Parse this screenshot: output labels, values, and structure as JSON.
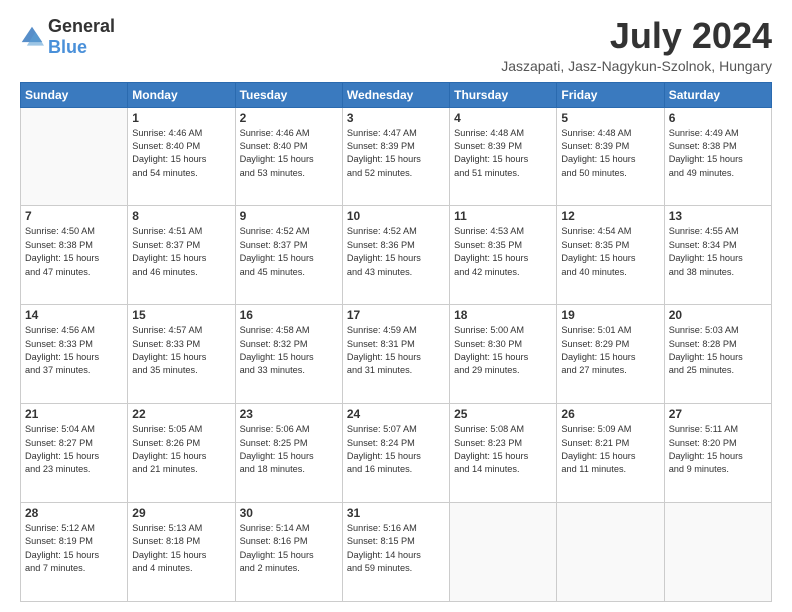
{
  "header": {
    "logo_general": "General",
    "logo_blue": "Blue",
    "month_title": "July 2024",
    "location": "Jaszapati, Jasz-Nagykun-Szolnok, Hungary"
  },
  "days_of_week": [
    "Sunday",
    "Monday",
    "Tuesday",
    "Wednesday",
    "Thursday",
    "Friday",
    "Saturday"
  ],
  "weeks": [
    [
      {
        "day": "",
        "info": ""
      },
      {
        "day": "1",
        "info": "Sunrise: 4:46 AM\nSunset: 8:40 PM\nDaylight: 15 hours\nand 54 minutes."
      },
      {
        "day": "2",
        "info": "Sunrise: 4:46 AM\nSunset: 8:40 PM\nDaylight: 15 hours\nand 53 minutes."
      },
      {
        "day": "3",
        "info": "Sunrise: 4:47 AM\nSunset: 8:39 PM\nDaylight: 15 hours\nand 52 minutes."
      },
      {
        "day": "4",
        "info": "Sunrise: 4:48 AM\nSunset: 8:39 PM\nDaylight: 15 hours\nand 51 minutes."
      },
      {
        "day": "5",
        "info": "Sunrise: 4:48 AM\nSunset: 8:39 PM\nDaylight: 15 hours\nand 50 minutes."
      },
      {
        "day": "6",
        "info": "Sunrise: 4:49 AM\nSunset: 8:38 PM\nDaylight: 15 hours\nand 49 minutes."
      }
    ],
    [
      {
        "day": "7",
        "info": "Sunrise: 4:50 AM\nSunset: 8:38 PM\nDaylight: 15 hours\nand 47 minutes."
      },
      {
        "day": "8",
        "info": "Sunrise: 4:51 AM\nSunset: 8:37 PM\nDaylight: 15 hours\nand 46 minutes."
      },
      {
        "day": "9",
        "info": "Sunrise: 4:52 AM\nSunset: 8:37 PM\nDaylight: 15 hours\nand 45 minutes."
      },
      {
        "day": "10",
        "info": "Sunrise: 4:52 AM\nSunset: 8:36 PM\nDaylight: 15 hours\nand 43 minutes."
      },
      {
        "day": "11",
        "info": "Sunrise: 4:53 AM\nSunset: 8:35 PM\nDaylight: 15 hours\nand 42 minutes."
      },
      {
        "day": "12",
        "info": "Sunrise: 4:54 AM\nSunset: 8:35 PM\nDaylight: 15 hours\nand 40 minutes."
      },
      {
        "day": "13",
        "info": "Sunrise: 4:55 AM\nSunset: 8:34 PM\nDaylight: 15 hours\nand 38 minutes."
      }
    ],
    [
      {
        "day": "14",
        "info": "Sunrise: 4:56 AM\nSunset: 8:33 PM\nDaylight: 15 hours\nand 37 minutes."
      },
      {
        "day": "15",
        "info": "Sunrise: 4:57 AM\nSunset: 8:33 PM\nDaylight: 15 hours\nand 35 minutes."
      },
      {
        "day": "16",
        "info": "Sunrise: 4:58 AM\nSunset: 8:32 PM\nDaylight: 15 hours\nand 33 minutes."
      },
      {
        "day": "17",
        "info": "Sunrise: 4:59 AM\nSunset: 8:31 PM\nDaylight: 15 hours\nand 31 minutes."
      },
      {
        "day": "18",
        "info": "Sunrise: 5:00 AM\nSunset: 8:30 PM\nDaylight: 15 hours\nand 29 minutes."
      },
      {
        "day": "19",
        "info": "Sunrise: 5:01 AM\nSunset: 8:29 PM\nDaylight: 15 hours\nand 27 minutes."
      },
      {
        "day": "20",
        "info": "Sunrise: 5:03 AM\nSunset: 8:28 PM\nDaylight: 15 hours\nand 25 minutes."
      }
    ],
    [
      {
        "day": "21",
        "info": "Sunrise: 5:04 AM\nSunset: 8:27 PM\nDaylight: 15 hours\nand 23 minutes."
      },
      {
        "day": "22",
        "info": "Sunrise: 5:05 AM\nSunset: 8:26 PM\nDaylight: 15 hours\nand 21 minutes."
      },
      {
        "day": "23",
        "info": "Sunrise: 5:06 AM\nSunset: 8:25 PM\nDaylight: 15 hours\nand 18 minutes."
      },
      {
        "day": "24",
        "info": "Sunrise: 5:07 AM\nSunset: 8:24 PM\nDaylight: 15 hours\nand 16 minutes."
      },
      {
        "day": "25",
        "info": "Sunrise: 5:08 AM\nSunset: 8:23 PM\nDaylight: 15 hours\nand 14 minutes."
      },
      {
        "day": "26",
        "info": "Sunrise: 5:09 AM\nSunset: 8:21 PM\nDaylight: 15 hours\nand 11 minutes."
      },
      {
        "day": "27",
        "info": "Sunrise: 5:11 AM\nSunset: 8:20 PM\nDaylight: 15 hours\nand 9 minutes."
      }
    ],
    [
      {
        "day": "28",
        "info": "Sunrise: 5:12 AM\nSunset: 8:19 PM\nDaylight: 15 hours\nand 7 minutes."
      },
      {
        "day": "29",
        "info": "Sunrise: 5:13 AM\nSunset: 8:18 PM\nDaylight: 15 hours\nand 4 minutes."
      },
      {
        "day": "30",
        "info": "Sunrise: 5:14 AM\nSunset: 8:16 PM\nDaylight: 15 hours\nand 2 minutes."
      },
      {
        "day": "31",
        "info": "Sunrise: 5:16 AM\nSunset: 8:15 PM\nDaylight: 14 hours\nand 59 minutes."
      },
      {
        "day": "",
        "info": ""
      },
      {
        "day": "",
        "info": ""
      },
      {
        "day": "",
        "info": ""
      }
    ]
  ]
}
